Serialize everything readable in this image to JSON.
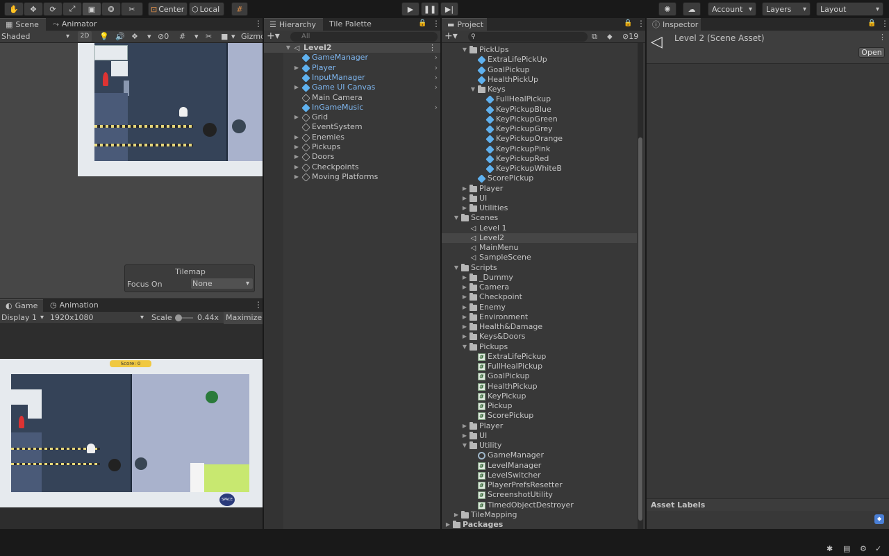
{
  "toolbar": {
    "center_label": "Center",
    "local_label": "Local",
    "account_label": "Account",
    "layers_label": "Layers",
    "layout_label": "Layout"
  },
  "scene_panel": {
    "tabs": [
      "Scene",
      "Animator"
    ],
    "shading_mode": "Shaded",
    "mode_2d": "2D",
    "hidden_count": "0",
    "gizmos_label": "Gizmo",
    "tilemap_overlay": {
      "title": "Tilemap",
      "focus_label": "Focus On",
      "focus_value": "None"
    }
  },
  "game_panel": {
    "tabs": [
      "Game",
      "Animation"
    ],
    "display": "Display 1",
    "resolution": "1920x1080",
    "scale_label": "Scale",
    "scale_value": "0.44x",
    "maximize_label": "Maximize O",
    "score_text": "Score: 0",
    "logo_text": "SPACE"
  },
  "hierarchy": {
    "tabs": [
      "Hierarchy",
      "Tile Palette"
    ],
    "search_placeholder": "All",
    "scene_name": "Level2",
    "items": [
      {
        "label": "GameManager",
        "icon": "blue-cube-icon",
        "blue": true,
        "has_children": false,
        "has_chevron": true
      },
      {
        "label": "Player",
        "icon": "blue-cube-icon",
        "blue": true,
        "has_children": true,
        "has_chevron": true
      },
      {
        "label": "InputManager",
        "icon": "blue-cube-icon",
        "blue": true,
        "has_children": false,
        "has_chevron": true
      },
      {
        "label": "Game UI Canvas",
        "icon": "blue-cube-icon",
        "blue": true,
        "has_children": true,
        "has_chevron": true
      },
      {
        "label": "Main Camera",
        "icon": "cube-icon",
        "blue": false,
        "has_children": false,
        "has_chevron": false
      },
      {
        "label": "InGameMusic",
        "icon": "blue-cube-icon",
        "blue": true,
        "has_children": false,
        "has_chevron": true
      },
      {
        "label": "Grid",
        "icon": "cube-icon",
        "blue": false,
        "has_children": true,
        "has_chevron": false
      },
      {
        "label": "EventSystem",
        "icon": "cube-icon",
        "blue": false,
        "has_children": false,
        "has_chevron": false
      },
      {
        "label": "Enemies",
        "icon": "cube-icon",
        "blue": false,
        "has_children": true,
        "has_chevron": false
      },
      {
        "label": "Pickups",
        "icon": "cube-icon",
        "blue": false,
        "has_children": true,
        "has_chevron": false
      },
      {
        "label": "Doors",
        "icon": "cube-icon",
        "blue": false,
        "has_children": true,
        "has_chevron": false
      },
      {
        "label": "Checkpoints",
        "icon": "cube-icon",
        "blue": false,
        "has_children": true,
        "has_chevron": false
      },
      {
        "label": "Moving Platforms",
        "icon": "cube-icon",
        "blue": false,
        "has_children": true,
        "has_chevron": false
      }
    ]
  },
  "project": {
    "tab": "Project",
    "hidden_count": "19",
    "rows": [
      {
        "label": "PickUps",
        "icon": "folder",
        "arrow": "open",
        "level": 2
      },
      {
        "label": "ExtraLifePickUp",
        "icon": "prefab",
        "arrow": "none",
        "level": 3
      },
      {
        "label": "GoalPickup",
        "icon": "prefab",
        "arrow": "none",
        "level": 3
      },
      {
        "label": "HealthPickUp",
        "icon": "prefab",
        "arrow": "none",
        "level": 3
      },
      {
        "label": "Keys",
        "icon": "folder",
        "arrow": "open",
        "level": 3
      },
      {
        "label": "FullHealPickup",
        "icon": "prefab",
        "arrow": "none",
        "level": 4
      },
      {
        "label": "KeyPickupBlue",
        "icon": "prefab",
        "arrow": "none",
        "level": 4
      },
      {
        "label": "KeyPickupGreen",
        "icon": "prefab",
        "arrow": "none",
        "level": 4
      },
      {
        "label": "KeyPickupGrey",
        "icon": "prefab",
        "arrow": "none",
        "level": 4
      },
      {
        "label": "KeyPickupOrange",
        "icon": "prefab",
        "arrow": "none",
        "level": 4
      },
      {
        "label": "KeyPickupPink",
        "icon": "prefab",
        "arrow": "none",
        "level": 4
      },
      {
        "label": "KeyPickupRed",
        "icon": "prefab",
        "arrow": "none",
        "level": 4
      },
      {
        "label": "KeyPickupWhiteB",
        "icon": "prefab",
        "arrow": "none",
        "level": 4
      },
      {
        "label": "ScorePickup",
        "icon": "prefab",
        "arrow": "none",
        "level": 3
      },
      {
        "label": "Player",
        "icon": "folder",
        "arrow": "closed",
        "level": 2
      },
      {
        "label": "UI",
        "icon": "folder",
        "arrow": "closed",
        "level": 2
      },
      {
        "label": "Utilities",
        "icon": "folder",
        "arrow": "closed",
        "level": 2
      },
      {
        "label": "Scenes",
        "icon": "folder",
        "arrow": "open",
        "level": 1
      },
      {
        "label": "Level 1",
        "icon": "unity",
        "arrow": "none",
        "level": 2
      },
      {
        "label": "Level2",
        "icon": "unity",
        "arrow": "none",
        "level": 2,
        "selected": true
      },
      {
        "label": "MainMenu",
        "icon": "unity",
        "arrow": "none",
        "level": 2
      },
      {
        "label": "SampleScene",
        "icon": "unity",
        "arrow": "none",
        "level": 2
      },
      {
        "label": "Scripts",
        "icon": "folder",
        "arrow": "open",
        "level": 1
      },
      {
        "label": "_Dummy",
        "icon": "folder",
        "arrow": "closed",
        "level": 2
      },
      {
        "label": "Camera",
        "icon": "folder",
        "arrow": "closed",
        "level": 2
      },
      {
        "label": "Checkpoint",
        "icon": "folder",
        "arrow": "closed",
        "level": 2
      },
      {
        "label": "Enemy",
        "icon": "folder",
        "arrow": "closed",
        "level": 2
      },
      {
        "label": "Environment",
        "icon": "folder",
        "arrow": "closed",
        "level": 2
      },
      {
        "label": "Health&Damage",
        "icon": "folder",
        "arrow": "closed",
        "level": 2
      },
      {
        "label": "Keys&Doors",
        "icon": "folder",
        "arrow": "closed",
        "level": 2
      },
      {
        "label": "Pickups",
        "icon": "folder",
        "arrow": "open",
        "level": 2
      },
      {
        "label": "ExtraLifePickup",
        "icon": "script",
        "arrow": "none",
        "level": 3
      },
      {
        "label": "FullHealPickup",
        "icon": "script",
        "arrow": "none",
        "level": 3
      },
      {
        "label": "GoalPickup",
        "icon": "script",
        "arrow": "none",
        "level": 3
      },
      {
        "label": "HealthPickup",
        "icon": "script",
        "arrow": "none",
        "level": 3
      },
      {
        "label": "KeyPickup",
        "icon": "script",
        "arrow": "none",
        "level": 3
      },
      {
        "label": "Pickup",
        "icon": "script",
        "arrow": "none",
        "level": 3
      },
      {
        "label": "ScorePickup",
        "icon": "script",
        "arrow": "none",
        "level": 3
      },
      {
        "label": "Player",
        "icon": "folder",
        "arrow": "closed",
        "level": 2
      },
      {
        "label": "UI",
        "icon": "folder",
        "arrow": "closed",
        "level": 2
      },
      {
        "label": "Utility",
        "icon": "folder",
        "arrow": "open",
        "level": 2
      },
      {
        "label": "GameManager",
        "icon": "gear",
        "arrow": "none",
        "level": 3
      },
      {
        "label": "LevelManager",
        "icon": "script",
        "arrow": "none",
        "level": 3
      },
      {
        "label": "LevelSwitcher",
        "icon": "script",
        "arrow": "none",
        "level": 3
      },
      {
        "label": "PlayerPrefsResetter",
        "icon": "script",
        "arrow": "none",
        "level": 3
      },
      {
        "label": "ScreenshotUtility",
        "icon": "script",
        "arrow": "none",
        "level": 3
      },
      {
        "label": "TimedObjectDestroyer",
        "icon": "script",
        "arrow": "none",
        "level": 3
      },
      {
        "label": "TileMapping",
        "icon": "folder",
        "arrow": "closed",
        "level": 1
      },
      {
        "label": "Packages",
        "icon": "folder",
        "arrow": "closed",
        "level": 0,
        "bold": true
      }
    ]
  },
  "inspector": {
    "tab": "Inspector",
    "asset_title": "Level 2 (Scene Asset)",
    "open_label": "Open",
    "asset_labels": "Asset Labels"
  }
}
